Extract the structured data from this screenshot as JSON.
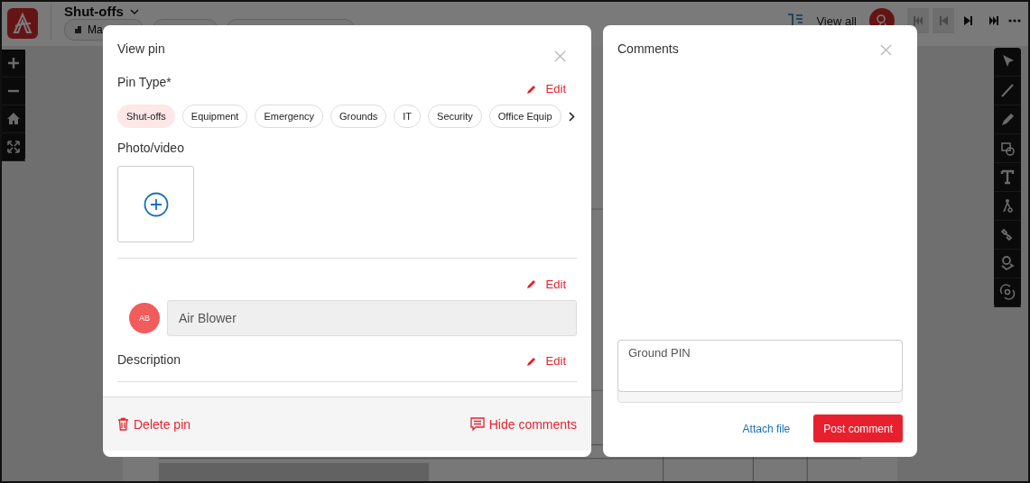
{
  "header": {
    "title": "Shut-offs",
    "tabs": [
      {
        "label": "Ma"
      }
    ],
    "view_all": "View all",
    "media_controls": [
      {
        "kind": "first",
        "disabled": true
      },
      {
        "kind": "previous",
        "disabled": true
      },
      {
        "kind": "next",
        "disabled": false
      },
      {
        "kind": "last",
        "disabled": false
      }
    ]
  },
  "view_pin": {
    "title": "View pin",
    "pin_type_label": "Pin Type*",
    "edit_label": "Edit",
    "chips": [
      {
        "label": "Shut-offs",
        "selected": true
      },
      {
        "label": "Equipment",
        "selected": false
      },
      {
        "label": "Emergency",
        "selected": false
      },
      {
        "label": "Grounds",
        "selected": false
      },
      {
        "label": "IT",
        "selected": false
      },
      {
        "label": "Security",
        "selected": false
      },
      {
        "label": "Office Equip",
        "selected": false
      }
    ],
    "photo_label": "Photo/video",
    "assignee_edit": "Edit",
    "assignee": {
      "initials": "AB",
      "name": "Air Blower"
    },
    "description_label": "Description",
    "description_edit": "Edit",
    "delete": "Delete pin",
    "hide_comments": "Hide comments"
  },
  "comments": {
    "title": "Comments",
    "comment": "Ground PIN",
    "attach": "Attach file",
    "post": "Post comment"
  }
}
